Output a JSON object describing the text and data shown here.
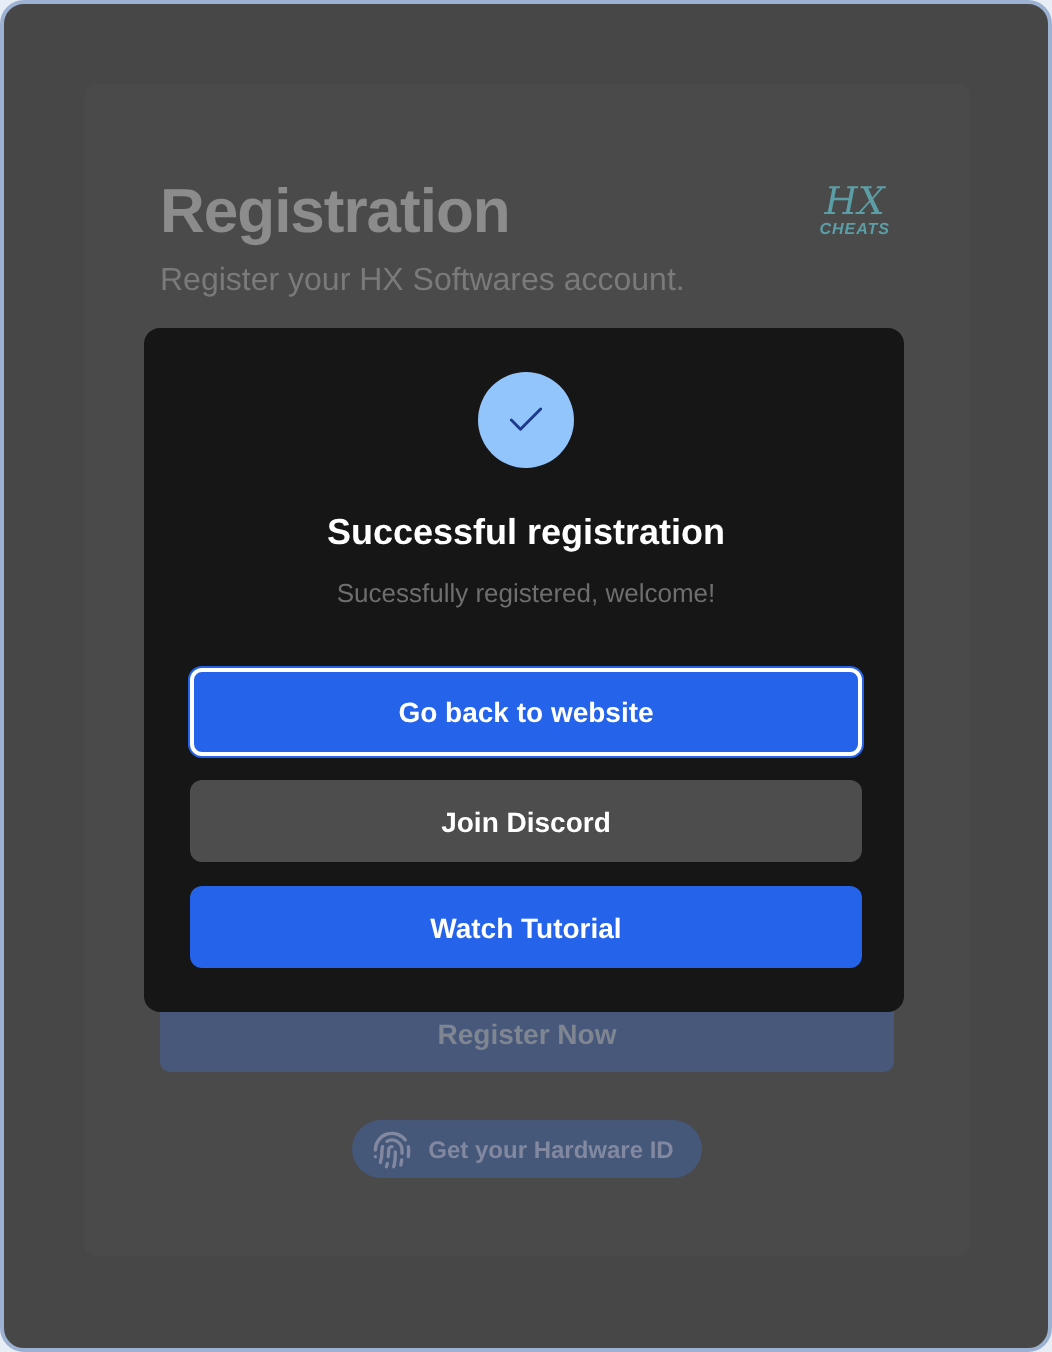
{
  "page": {
    "title": "Registration",
    "subtitle": "Register your HX Softwares account.",
    "logo": {
      "mark": "HX",
      "sub": "CHEATS"
    },
    "register_button": "Register Now",
    "hardware_id_button": "Get your Hardware ID"
  },
  "dialog": {
    "title": "Successful registration",
    "message": "Sucessfully registered, welcome!",
    "buttons": [
      {
        "label": "Go back to website",
        "kind": "primary",
        "focused": true
      },
      {
        "label": "Join Discord",
        "kind": "secondary",
        "focused": false
      },
      {
        "label": "Watch Tutorial",
        "kind": "primary",
        "focused": false
      }
    ]
  }
}
